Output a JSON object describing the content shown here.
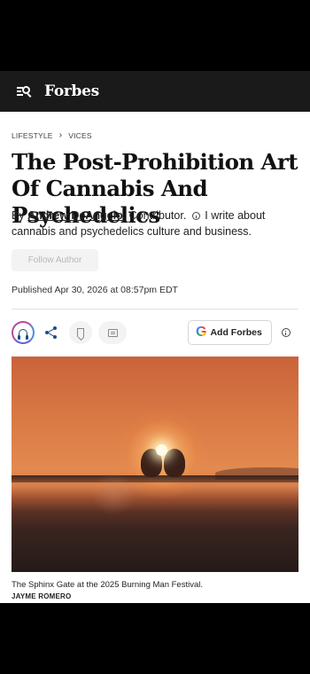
{
  "header": {
    "logo": "Forbes",
    "menu_search_icon": "menu-search-icon"
  },
  "breadcrumb": {
    "section": "LIFESTYLE",
    "subsection": "VICES"
  },
  "article": {
    "headline": "The Post-Prohibition Art Of Cannabis And Psychedelics",
    "byline_prefix": "By",
    "author": "Andrew DeAngelo",
    "author_role": ", Contributor.",
    "author_bio": "I write about cannabis and psychedelics culture and business.",
    "follow_label": "Follow Author",
    "published": "Published Apr 30, 2026 at 08:57pm EDT"
  },
  "actions": {
    "listen_icon": "headphones-icon",
    "share_icon": "share-icon",
    "bookmark_icon": "bookmark-icon",
    "comment_icon": "comment-icon",
    "add_forbes_label": "Add Forbes",
    "google_g": "G",
    "info_icon": "info-icon"
  },
  "photo": {
    "caption": "The Sphinx Gate at the 2025 Burning Man Festival.",
    "credit": "JAYME ROMERO"
  },
  "colors": {
    "topbar": "#1a1a1a",
    "link_blue": "#1a4e8a",
    "listen_ring": "#b44b9e"
  }
}
